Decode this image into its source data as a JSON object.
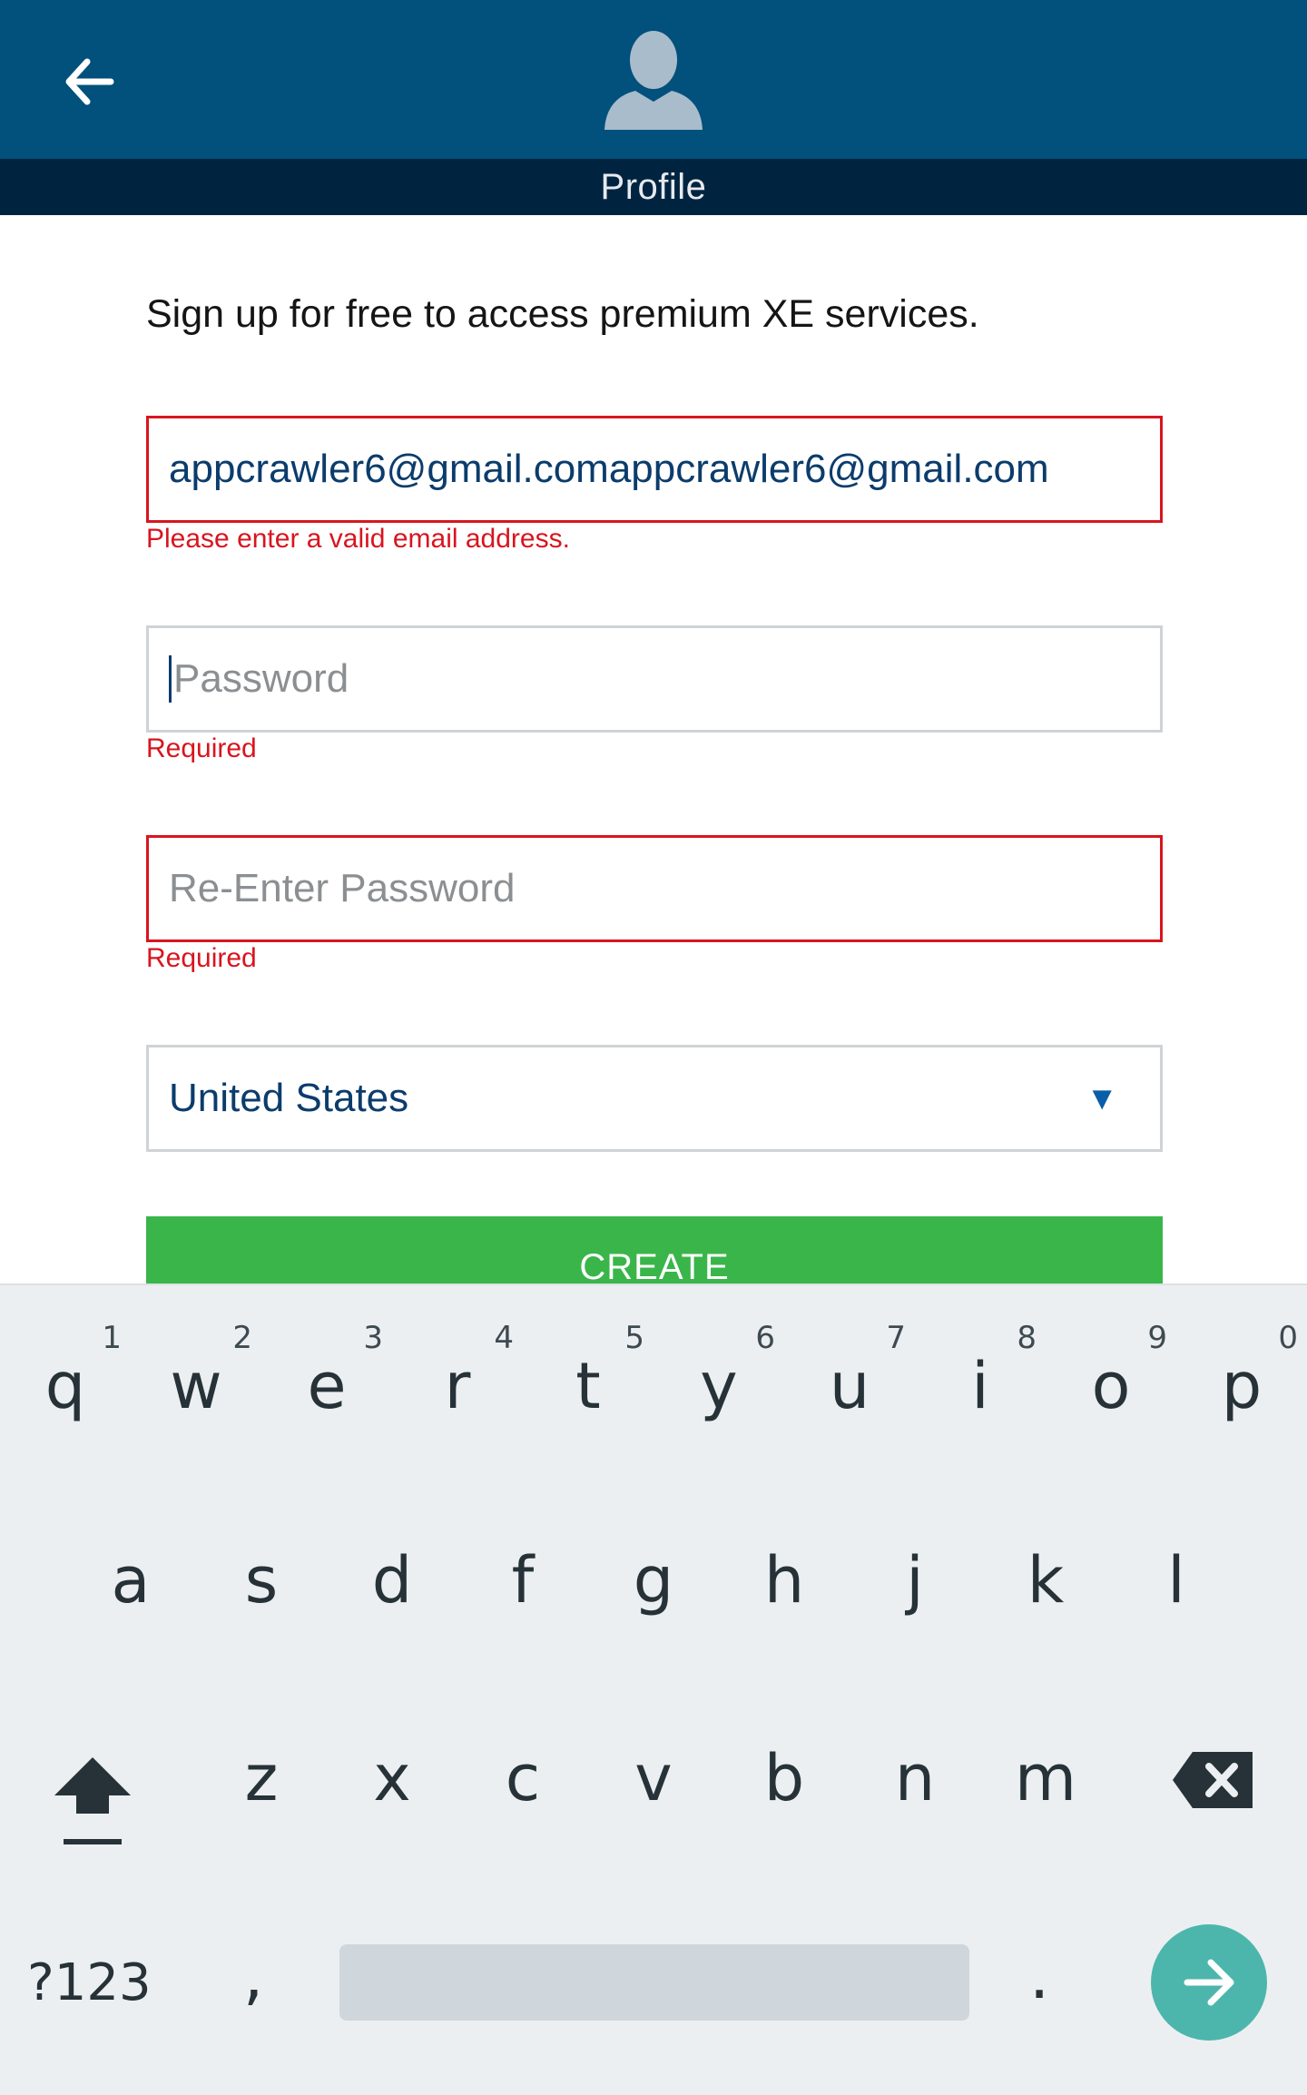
{
  "header": {
    "back_icon": "arrow-left-icon",
    "avatar_icon": "user-silhouette-icon",
    "title": "Profile"
  },
  "form": {
    "intro": "Sign up for free to access premium XE services.",
    "email": {
      "value": "appcrawler6@gmail.comappcrawler6@gmail.com",
      "error": "Please enter a valid email address."
    },
    "password": {
      "placeholder": "Password",
      "error": "Required"
    },
    "reenter_password": {
      "placeholder": "Re-Enter Password",
      "error": "Required"
    },
    "country": {
      "selected": "United States"
    },
    "create_label": "CREATE"
  },
  "keyboard": {
    "row1": [
      {
        "key": "q",
        "hint": "1"
      },
      {
        "key": "w",
        "hint": "2"
      },
      {
        "key": "e",
        "hint": "3"
      },
      {
        "key": "r",
        "hint": "4"
      },
      {
        "key": "t",
        "hint": "5"
      },
      {
        "key": "y",
        "hint": "6"
      },
      {
        "key": "u",
        "hint": "7"
      },
      {
        "key": "i",
        "hint": "8"
      },
      {
        "key": "o",
        "hint": "9"
      },
      {
        "key": "p",
        "hint": "0"
      }
    ],
    "row2": [
      "a",
      "s",
      "d",
      "f",
      "g",
      "h",
      "j",
      "k",
      "l"
    ],
    "row3": [
      "z",
      "x",
      "c",
      "v",
      "b",
      "n",
      "m"
    ],
    "symbols_label": "?123",
    "comma": ",",
    "period": ".",
    "shift_icon": "shift-arrow-icon",
    "delete_icon": "backspace-icon",
    "enter_icon": "arrow-right-icon"
  },
  "colors": {
    "header": "#02507c",
    "header_bar": "#002440",
    "error": "#d8151f",
    "button": "#3ab54a",
    "enter_key": "#4db6ac",
    "keyboard_bg": "#eceff1"
  }
}
